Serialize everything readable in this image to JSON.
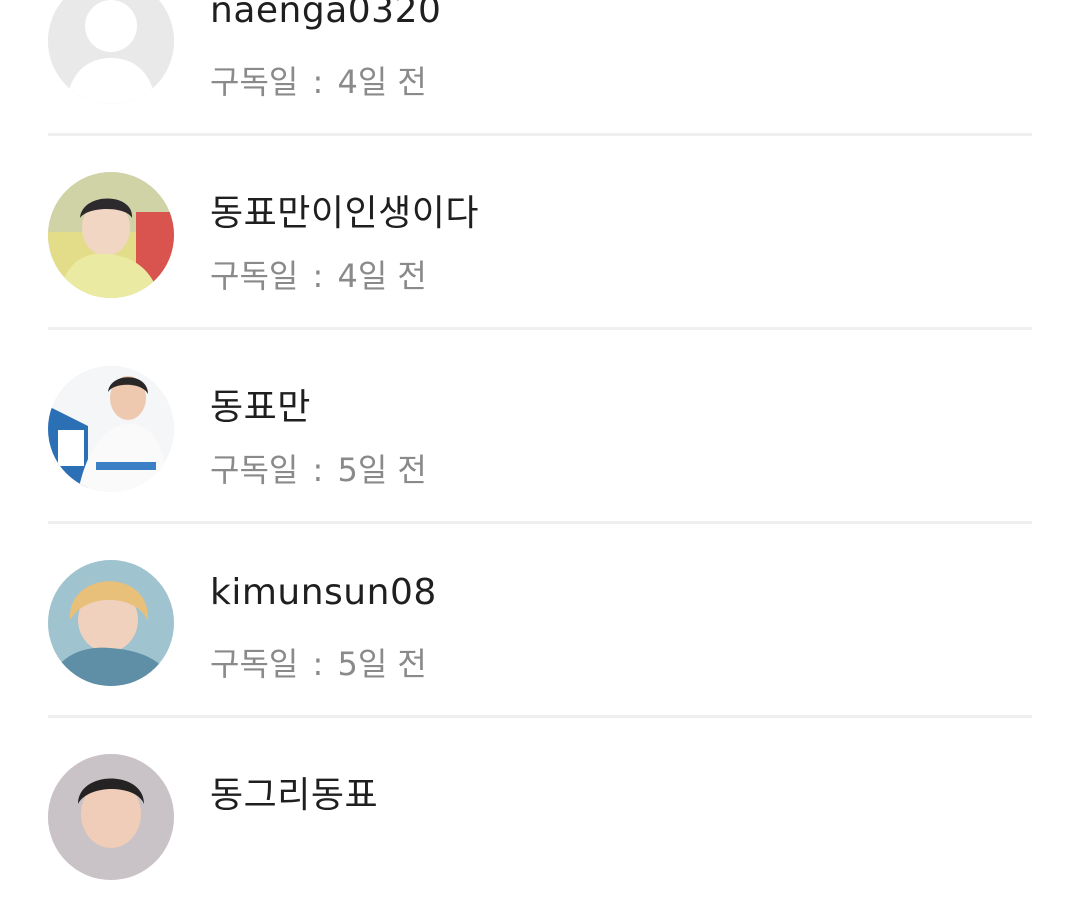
{
  "subscribers": [
    {
      "name": "naenga0320",
      "label": "구독일",
      "separator": ":",
      "when": "4일 전",
      "avatar": "default-avatar-icon"
    },
    {
      "name": "동표만이인생이다",
      "label": "구독일",
      "separator": ":",
      "when": "4일 전",
      "avatar": "user-photo"
    },
    {
      "name": "동표만",
      "label": "구독일",
      "separator": ":",
      "when": "5일 전",
      "avatar": "user-photo"
    },
    {
      "name": "kimunsun08",
      "label": "구독일",
      "separator": ":",
      "when": "5일 전",
      "avatar": "user-photo"
    },
    {
      "name": "동그리동표",
      "label": "",
      "separator": "",
      "when": "",
      "avatar": "user-photo"
    }
  ],
  "colors": {
    "name_text": "#1f1f1f",
    "sub_text": "#8a8a8a",
    "divider": "#efefef",
    "default_avatar_bg": "#e6e6e6"
  }
}
